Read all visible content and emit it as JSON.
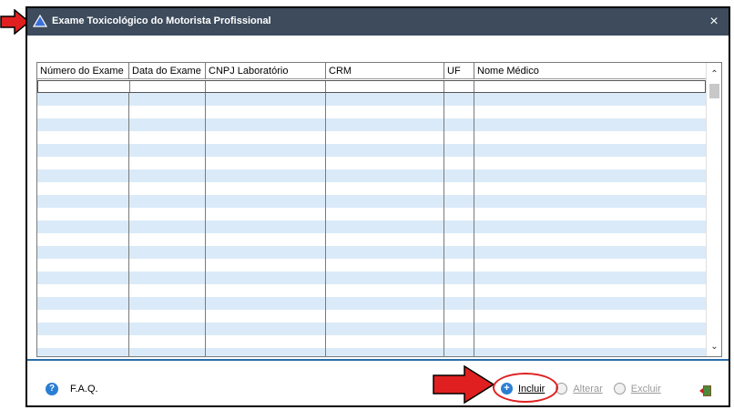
{
  "window": {
    "title": "Exame Toxicológico do Motorista Profissional",
    "close_glyph": "×"
  },
  "grid": {
    "columns": [
      "Número do Exame",
      "Data do Exame",
      "CNPJ Laboratório",
      "CRM",
      "UF",
      "Nome Médico"
    ],
    "row_count": 22
  },
  "footer": {
    "faq_label": "F.A.Q.",
    "actions": [
      {
        "label": "Incluir",
        "enabled": true,
        "icon": "add-icon"
      },
      {
        "label": "Alterar",
        "enabled": false,
        "icon": "edit-icon"
      },
      {
        "label": "Excluir",
        "enabled": false,
        "icon": "delete-icon"
      }
    ],
    "exit_icon": "exit-door-icon"
  },
  "colors": {
    "titlebar": "#3d4b5c",
    "row_alt": "#daeaf8",
    "accent": "#2a7fd4",
    "annotation": "#e02020"
  }
}
